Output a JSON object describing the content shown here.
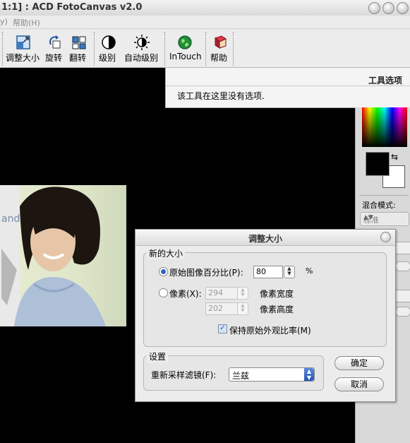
{
  "window": {
    "title": "1:1] : ACD FotoCanvas v2.0"
  },
  "menu": {
    "items": [
      "y)",
      "帮助(H)"
    ]
  },
  "toolbar": {
    "buttons": [
      {
        "label": "调整大小",
        "icon": "resize-icon"
      },
      {
        "label": "旋转",
        "icon": "rotate-icon"
      },
      {
        "label": "翻转",
        "icon": "flip-icon"
      },
      {
        "label": "级别",
        "icon": "levels-icon"
      },
      {
        "label": "自动级别",
        "icon": "auto-levels-icon"
      },
      {
        "label": "InTouch",
        "icon": "intouch-globe-icon"
      },
      {
        "label": "帮助",
        "icon": "help-book-icon"
      }
    ]
  },
  "tool_options": {
    "header": "工具选项",
    "message": "该工具在这里没有选项."
  },
  "right_panel": {
    "blend_label": "混合模式:",
    "blend_value": "标准",
    "fg_color": "#000000",
    "bg_color": "#ffffff"
  },
  "dialog": {
    "title": "调整大小",
    "new_size_group": "新的大小",
    "percent_label": "原始图像百分比(P):",
    "percent_value": "80",
    "percent_unit": "%",
    "pixels_label": "像素(X):",
    "width_value": "294",
    "height_value": "202",
    "width_label": "像素宽度",
    "height_label": "像素高度",
    "keep_aspect_label": "保持原始外观比率(M)",
    "settings_group": "设置",
    "filter_label": "重新采样滤镜(F):",
    "filter_value": "兰兹",
    "ok_label": "确定",
    "cancel_label": "取消"
  },
  "colors": {
    "accent": "#2c63c6",
    "canvas": "#000000"
  }
}
